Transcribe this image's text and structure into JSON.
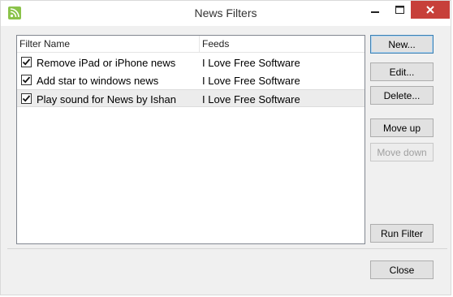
{
  "window": {
    "title": "News Filters",
    "accent_close": "#c7403a",
    "icon": "rss-app-icon"
  },
  "listview": {
    "columns": [
      "Filter Name",
      "Feeds"
    ],
    "rows": [
      {
        "name": "Remove iPad or iPhone news",
        "feed": "I Love Free Software",
        "checked": true,
        "selected": false
      },
      {
        "name": "Add star to windows news",
        "feed": "I Love Free Software",
        "checked": true,
        "selected": false
      },
      {
        "name": "Play sound for News by Ishan",
        "feed": "I Love Free Software",
        "checked": true,
        "selected": true
      }
    ]
  },
  "buttons": {
    "new": "New...",
    "edit": "Edit...",
    "delete": "Delete...",
    "move_up": "Move up",
    "move_down": "Move down",
    "run_filter": "Run Filter",
    "close": "Close"
  }
}
